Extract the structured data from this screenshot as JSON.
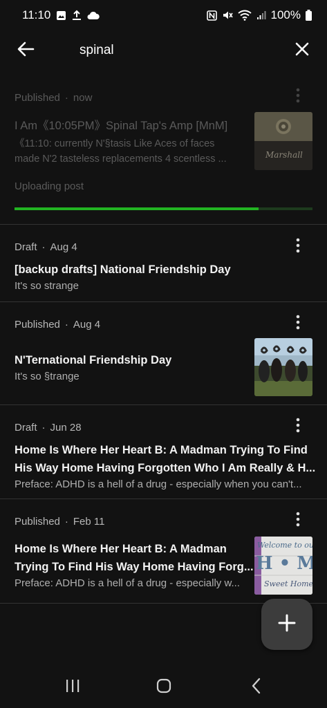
{
  "status_bar": {
    "time": "11:10",
    "battery": "100%",
    "left_icons": [
      "gallery-icon",
      "upload-icon",
      "cloud-icon"
    ],
    "right_icons": [
      "nfc-icon",
      "mute-icon",
      "wifi-icon",
      "signal-icon",
      "battery-icon"
    ]
  },
  "search": {
    "query": "spinal",
    "back_icon": "arrow-left-icon",
    "close_icon": "close-icon"
  },
  "posts": [
    {
      "status": "Published",
      "date": "now",
      "title": "I Am《10:05PM》Spinal Tap's Amp [MnM]",
      "excerpt_line1": "《11:10: currently N'§tasis Like Aces of faces",
      "excerpt_line2": "made N'2 tasteless replacements 4 scentless ...",
      "upload_label": "Uploading post",
      "upload_progress": 0.82,
      "thumbnail_text": "Marshall"
    },
    {
      "status": "Draft",
      "date": "Aug 4",
      "title": "[backup drafts] National Friendship Day",
      "excerpt": "It's so strange"
    },
    {
      "status": "Published",
      "date": "Aug 4",
      "title": "N'Ternational Friendship Day",
      "excerpt": "It's so §trange"
    },
    {
      "status": "Draft",
      "date": "Jun 28",
      "title_line1": "Home Is Where Her Heart B: A Madman Trying To Find",
      "title_line2": "His Way Home Having Forgotten Who I Am Really & H...",
      "excerpt": "Preface: ADHD is a hell of a drug - especially when you can't..."
    },
    {
      "status": "Published",
      "date": "Feb 11",
      "title_line1": "Home Is Where Her Heart B: A Madman",
      "title_line2": "Trying To Find His Way Home Having Forg...",
      "excerpt": "Preface: ADHD is a hell of a drug - especially w...",
      "thumbnail_text_1": "Welcome to our",
      "thumbnail_text_2": "H • ME",
      "thumbnail_text_3": "Sweet Home"
    }
  ],
  "separator": "·",
  "fab_icon": "plus-icon",
  "nav": [
    "recents-icon",
    "home-icon",
    "back-icon"
  ],
  "colors": {
    "background": "#121212",
    "progress": "#22b422",
    "fab": "#3c3c3c"
  }
}
